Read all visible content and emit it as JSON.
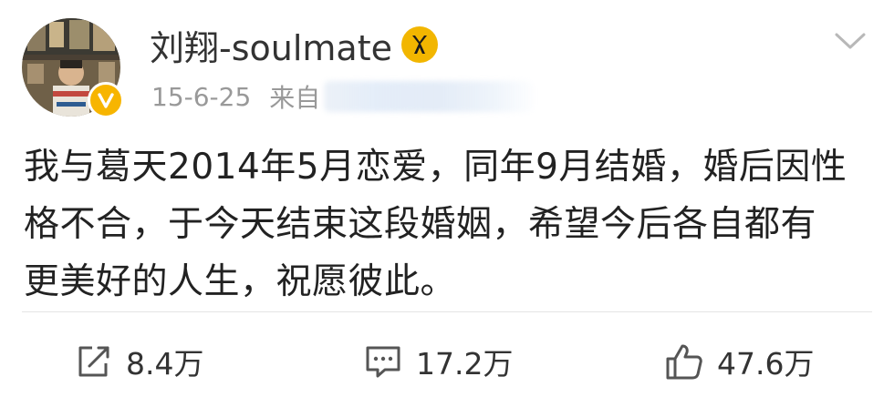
{
  "user": {
    "name": "刘翔-soulmate"
  },
  "meta": {
    "date": "15-6-25",
    "source_prefix": "来自"
  },
  "post": {
    "lines": [
      "我与葛天2014年5月恋爱，同年9月结婚，婚后因性",
      "格不合，于今天结束这段婚姻，希望今后各自都有",
      "更美好的人生，祝愿彼此。"
    ]
  },
  "actions": {
    "repost": "8.4万",
    "comment": "17.2万",
    "like": "47.6万"
  },
  "colors": {
    "badge": "#f2b600",
    "text": "#222222",
    "meta": "#999999",
    "divider": "#e5e5e5"
  }
}
